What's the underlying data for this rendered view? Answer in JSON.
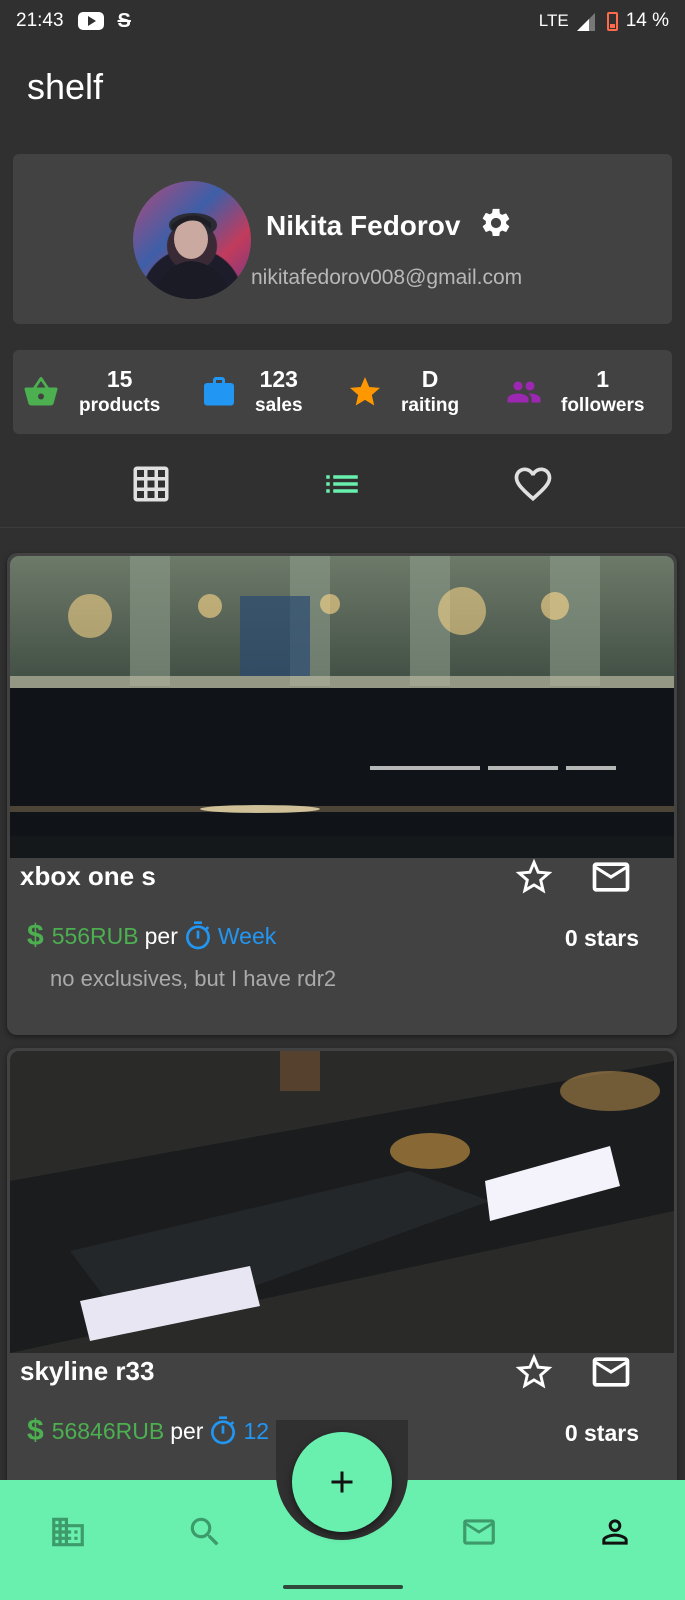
{
  "status_bar": {
    "time": "21:43",
    "network": "LTE",
    "battery": "14 %",
    "icons": [
      "youtube-icon",
      "s-icon",
      "signal-icon",
      "battery-icon"
    ]
  },
  "app": {
    "title": "shelf"
  },
  "profile": {
    "name": "Nikita Fedorov",
    "email": "nikitafedorov008@gmail.com"
  },
  "stats": [
    {
      "value": "15",
      "label": "products",
      "icon": "basket-icon",
      "color": "#4caf50"
    },
    {
      "value": "123",
      "label": "sales",
      "icon": "briefcase-icon",
      "color": "#2196f3"
    },
    {
      "value": "D",
      "label": "raiting",
      "icon": "star-icon",
      "color": "#ff9800"
    },
    {
      "value": "1",
      "label": "followers",
      "icon": "people-icon",
      "color": "#9c27b0"
    }
  ],
  "view_tabs": {
    "icons": [
      "grid-icon",
      "list-icon",
      "heart-icon"
    ],
    "active": "list-icon",
    "active_color": "#69f0ae"
  },
  "products": [
    {
      "title": "xbox one s",
      "price": "556RUB",
      "per": "per",
      "period": "Week",
      "stars": "0 stars",
      "description": "no exclusives, but  I have rdr2"
    },
    {
      "title": "skyline r33",
      "price": "56846RUB",
      "per": "per",
      "period": "12",
      "stars": "0 stars"
    }
  ],
  "bottom_nav": {
    "items": [
      "building-icon",
      "search-icon",
      "mail-icon",
      "person-icon"
    ],
    "active": "person-icon",
    "background": "#69f0ae",
    "fab_icon": "plus-icon"
  }
}
